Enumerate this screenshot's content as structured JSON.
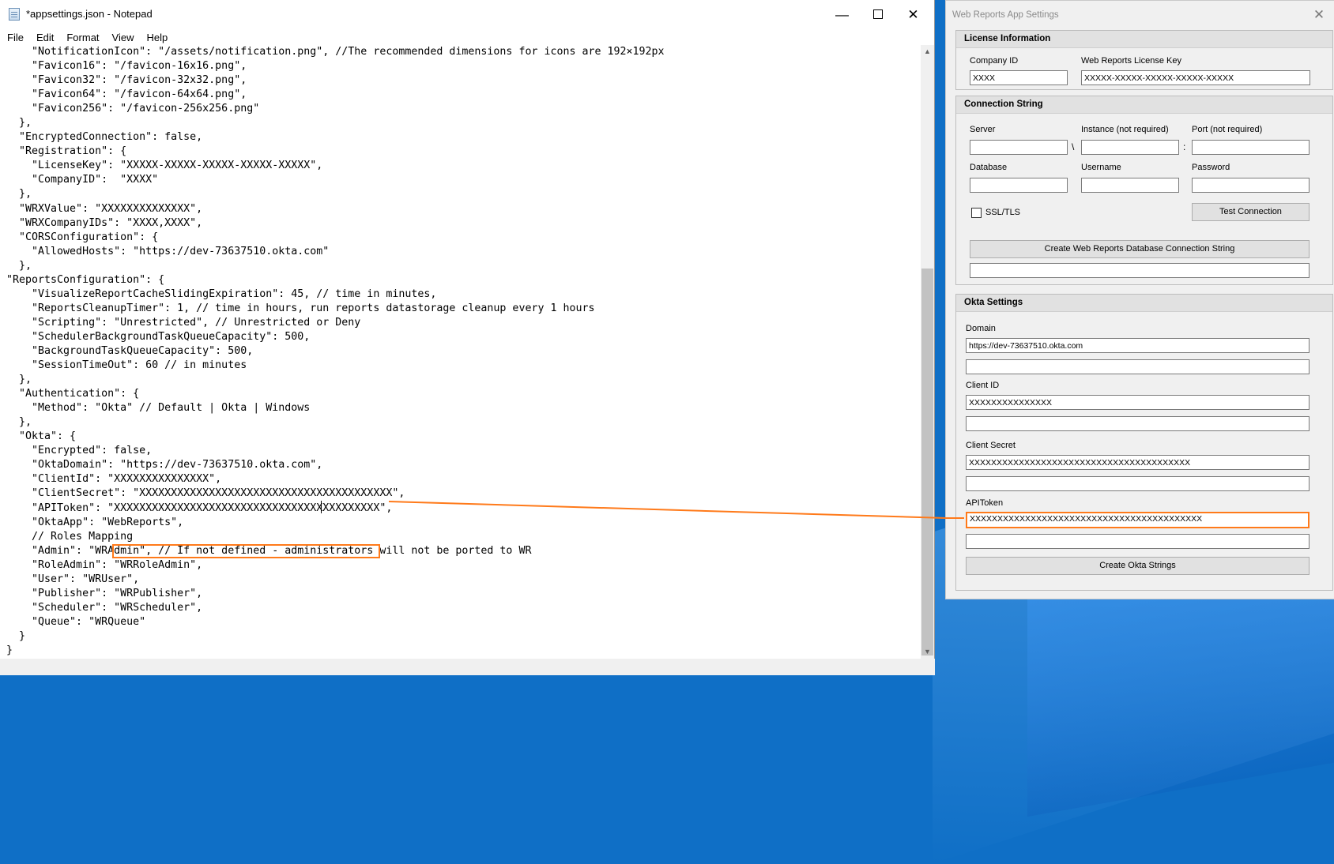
{
  "notepad": {
    "title": "*appsettings.json - Notepad",
    "window_buttons": {
      "minimize": "—",
      "close": "✕"
    },
    "menu": [
      "File",
      "Edit",
      "Format",
      "View",
      "Help"
    ],
    "lines": [
      "    \"NotificationIcon\": \"/assets/notification.png\", //The recommended dimensions for icons are 192×192px",
      "    \"Favicon16\": \"/favicon-16x16.png\",",
      "    \"Favicon32\": \"/favicon-32x32.png\",",
      "    \"Favicon64\": \"/favicon-64x64.png\",",
      "    \"Favicon256\": \"/favicon-256x256.png\"",
      "  },",
      "  \"EncryptedConnection\": false,",
      "  \"Registration\": {",
      "    \"LicenseKey\": \"XXXXX-XXXXX-XXXXX-XXXXX-XXXXX\",",
      "    \"CompanyID\":  \"XXXX\"",
      "  },",
      "  \"WRXValue\": \"XXXXXXXXXXXXXX\",",
      "  \"WRXCompanyIDs\": \"XXXX,XXXX\",",
      "  \"CORSConfiguration\": {",
      "    \"AllowedHosts\": \"https://dev-73637510.okta.com\"",
      "  },",
      "\"ReportsConfiguration\": {",
      "    \"VisualizeReportCacheSlidingExpiration\": 45, // time in minutes,",
      "    \"ReportsCleanupTimer\": 1, // time in hours, run reports datastorage cleanup every 1 hours",
      "    \"Scripting\": \"Unrestricted\", // Unrestricted or Deny",
      "    \"SchedulerBackgroundTaskQueueCapacity\": 500,",
      "    \"BackgroundTaskQueueCapacity\": 500,",
      "    \"SessionTimeOut\": 60 // in minutes",
      "  },",
      "  \"Authentication\": {",
      "    \"Method\": \"Okta\" // Default | Okta | Windows",
      "  },",
      "  \"Okta\": {",
      "    \"Encrypted\": false,",
      "    \"OktaDomain\": \"https://dev-73637510.okta.com\",",
      "    \"ClientId\": \"XXXXXXXXXXXXXXX\",",
      "    \"ClientSecret\": \"XXXXXXXXXXXXXXXXXXXXXXXXXXXXXXXXXXXXXXXX\",",
      "    \"APIToken\": \"XXXXXXXXXXXXXXXXXXXXXXXXXXXXXXXXXXXXXXXXXX\",",
      "    \"OktaApp\": \"WebReports\",",
      "    // Roles Mapping",
      "    \"Admin\": \"WRAdmin\", // If not defined - administrators will not be ported to WR",
      "    \"RoleAdmin\": \"WRRoleAdmin\",",
      "    \"User\": \"WRUser\",",
      "    \"Publisher\": \"WRPublisher\",",
      "    \"Scheduler\": \"WRScheduler\",",
      "    \"Queue\": \"WRQueue\"",
      "  }",
      "}"
    ]
  },
  "dialog": {
    "title": "Web Reports App Settings",
    "close_glyph": "✕",
    "license": {
      "header": "License Information",
      "company_id_label": "Company ID",
      "company_id_value": "XXXX",
      "license_key_label": "Web Reports License Key",
      "license_key_value": "XXXXX-XXXXX-XXXXX-XXXXX-XXXXX"
    },
    "connection": {
      "header": "Connection String",
      "server_label": "Server",
      "instance_label": "Instance (not required)",
      "port_label": "Port (not required)",
      "backslash": "\\",
      "colon": ":",
      "database_label": "Database",
      "username_label": "Username",
      "password_label": "Password",
      "ssl_label": "SSL/TLS",
      "test_button": "Test Connection",
      "create_button": "Create Web Reports Database Connection String"
    },
    "okta": {
      "header": "Okta Settings",
      "domain_label": "Domain",
      "domain_value": "https://dev-73637510.okta.com",
      "client_id_label": "Client ID",
      "client_id_value": "XXXXXXXXXXXXXXX",
      "client_secret_label": "Client Secret",
      "client_secret_value": "XXXXXXXXXXXXXXXXXXXXXXXXXXXXXXXXXXXXXXXX",
      "api_token_label": "APIToken",
      "api_token_value": "XXXXXXXXXXXXXXXXXXXXXXXXXXXXXXXXXXXXXXXXXX",
      "create_button": "Create Okta Strings"
    }
  },
  "colors": {
    "highlight": "#ff7a1a",
    "desktop": "#0f6fc6"
  }
}
